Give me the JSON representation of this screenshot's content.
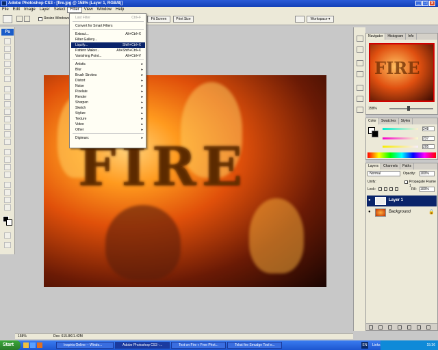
{
  "window": {
    "title": "Adobe Photoshop CS3 - [fire.jpg @ 158% (Layer 1, RGB/8)]"
  },
  "menubar": [
    "File",
    "Edit",
    "Image",
    "Layer",
    "Select",
    "Filter",
    "View",
    "Window",
    "Help"
  ],
  "options": {
    "resize_windows": "Resize Windows",
    "fit_screen": "Fit Screen",
    "print_size": "Print Size",
    "workspace": "Workspace"
  },
  "filter_menu": {
    "items": [
      {
        "label": "Last Filter",
        "shortcut": "Ctrl+F",
        "state": "disabled"
      },
      {
        "label": "Convert for Smart Filters",
        "shortcut": "",
        "state": "normal"
      },
      {
        "label": "Extract...",
        "shortcut": "Alt+Ctrl+X",
        "state": "normal"
      },
      {
        "label": "Filter Gallery...",
        "shortcut": "",
        "state": "normal"
      },
      {
        "label": "Liquify...",
        "shortcut": "Shift+Ctrl+X",
        "state": "highlighted"
      },
      {
        "label": "Pattern Maker...",
        "shortcut": "Alt+Shift+Ctrl+X",
        "state": "normal"
      },
      {
        "label": "Vanishing Point...",
        "shortcut": "Alt+Ctrl+V",
        "state": "normal"
      },
      {
        "label": "Artistic",
        "submenu": true
      },
      {
        "label": "Blur",
        "submenu": true
      },
      {
        "label": "Brush Strokes",
        "submenu": true
      },
      {
        "label": "Distort",
        "submenu": true
      },
      {
        "label": "Noise",
        "submenu": true
      },
      {
        "label": "Pixelate",
        "submenu": true
      },
      {
        "label": "Render",
        "submenu": true
      },
      {
        "label": "Sharpen",
        "submenu": true
      },
      {
        "label": "Sketch",
        "submenu": true
      },
      {
        "label": "Stylize",
        "submenu": true
      },
      {
        "label": "Texture",
        "submenu": true
      },
      {
        "label": "Video",
        "submenu": true
      },
      {
        "label": "Other",
        "submenu": true
      },
      {
        "label": "Digimarc",
        "submenu": true
      }
    ]
  },
  "canvas": {
    "text": "FIRE"
  },
  "navigator": {
    "tabs": [
      "Navigator",
      "Histogram",
      "Info"
    ],
    "zoom": "158%"
  },
  "color_panel": {
    "tabs": [
      "Color",
      "Swatches",
      "Styles"
    ],
    "r": "248",
    "g": "237",
    "b": "205"
  },
  "layers_panel": {
    "tabs": [
      "Layers",
      "Channels",
      "Paths"
    ],
    "blend_mode": "Normal",
    "opacity_label": "Opacity:",
    "opacity": "100%",
    "unify_label": "Unify:",
    "propagate": "Propagate Frame 1",
    "lock_label": "Lock:",
    "fill_label": "Fill:",
    "fill": "100%",
    "layers": [
      {
        "name": "Layer 1",
        "selected": true
      },
      {
        "name": "Background",
        "selected": false
      }
    ]
  },
  "status": {
    "zoom": "158%",
    "doc": "Doc: 615.8K/1.42M"
  },
  "taskbar": {
    "start": "Start",
    "tasks": [
      "Inspiria Online -- Windo...",
      "Adobe Photoshop CS3 -...",
      "Text on Fire « Free Phot...",
      "Tekst fire Smudge Tool e..."
    ],
    "tray_lang": "EN",
    "tray_links": "Links",
    "clock": "15:36"
  },
  "colors": {
    "title_blue": "#1240b8",
    "highlight": "#0a246a",
    "panel_gray": "#ece9d8"
  }
}
